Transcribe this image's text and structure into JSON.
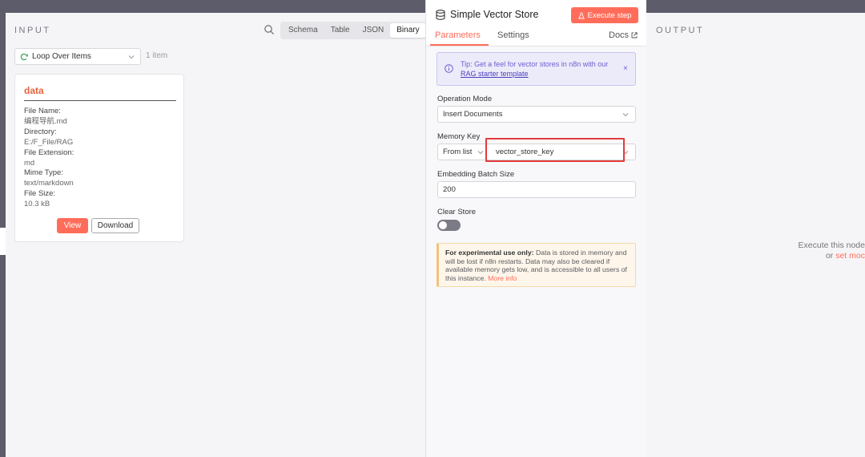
{
  "input_panel": {
    "title": "INPUT",
    "view_tabs": [
      "Schema",
      "Table",
      "JSON",
      "Binary"
    ],
    "active_view": "Binary",
    "node_selector": "Loop Over Items",
    "item_count": "1 item",
    "card": {
      "title": "data",
      "fields": [
        {
          "label": "File Name:",
          "value": "编程导航.md"
        },
        {
          "label": "Directory:",
          "value": "E:/F_File/RAG"
        },
        {
          "label": "File Extension:",
          "value": "md"
        },
        {
          "label": "Mime Type:",
          "value": "text/markdown"
        },
        {
          "label": "File Size:",
          "value": "10.3 kB"
        }
      ],
      "view_label": "View",
      "download_label": "Download"
    }
  },
  "node": {
    "name": "Simple Vector Store",
    "execute_label": "Execute step",
    "tabs": {
      "parameters": "Parameters",
      "settings": "Settings",
      "docs": "Docs"
    },
    "tip": {
      "text": "Tip: Get a feel for vector stores in n8n with our",
      "link": "RAG starter template",
      "close": "×"
    },
    "operation_mode": {
      "label": "Operation Mode",
      "value": "Insert Documents"
    },
    "memory_key": {
      "label": "Memory Key",
      "mode": "From list",
      "value": "vector_store_key"
    },
    "batch_size": {
      "label": "Embedding Batch Size",
      "value": "200"
    },
    "clear_store": {
      "label": "Clear Store",
      "enabled": false
    },
    "warning": {
      "bold": "For experimental use only:",
      "text": " Data is stored in memory and will be lost if n8n restarts. Data may also be cleared if available memory gets low, and is accessible to all users of this instance. ",
      "link": "More info"
    }
  },
  "output_panel": {
    "title": "OUTPUT",
    "hint_line1": "Execute this node",
    "hint_or": "or ",
    "hint_link": "set moc"
  },
  "colors": {
    "accent": "#ff6d5a",
    "tip_purple": "#6b5fd0",
    "highlight_red": "#e23b3b"
  }
}
